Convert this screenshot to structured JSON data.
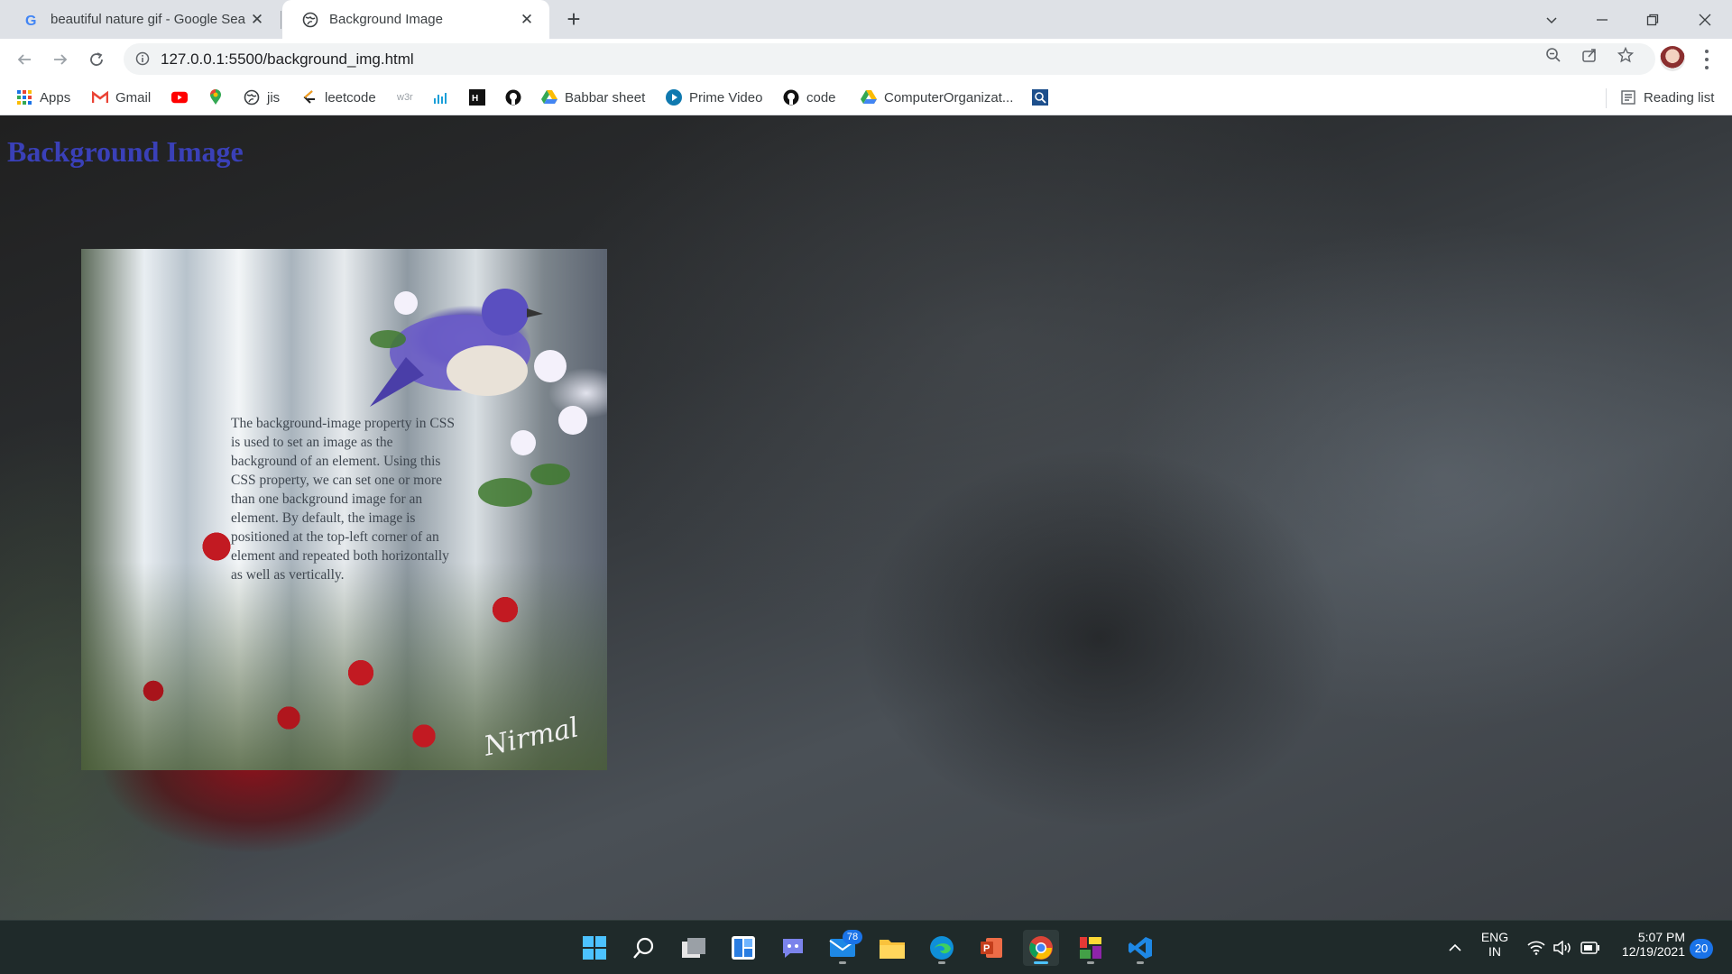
{
  "browser": {
    "tabs": [
      {
        "title": "beautiful nature gif - Google Sea",
        "favicon": "google-g-icon",
        "active": false
      },
      {
        "title": "Background Image",
        "favicon": "globe-icon",
        "active": true
      }
    ],
    "url": "127.0.0.1:5500/background_img.html",
    "bookmarks": [
      {
        "label": "Apps",
        "icon": "apps-grid-icon"
      },
      {
        "label": "Gmail",
        "icon": "gmail-icon"
      },
      {
        "label": "",
        "icon": "youtube-icon"
      },
      {
        "label": "",
        "icon": "maps-icon"
      },
      {
        "label": "jis",
        "icon": "globe-icon"
      },
      {
        "label": "leetcode",
        "icon": "leetcode-icon"
      },
      {
        "label": "w3r",
        "icon": "w3resource-icon"
      },
      {
        "label": "",
        "icon": "chart-icon"
      },
      {
        "label": "",
        "icon": "hackerrank-icon"
      },
      {
        "label": "",
        "icon": "github-icon"
      },
      {
        "label": "Babbar sheet",
        "icon": "drive-icon"
      },
      {
        "label": "Prime Video",
        "icon": "prime-video-icon"
      },
      {
        "label": "code",
        "icon": "github-icon"
      },
      {
        "label": "ComputerOrganizat...",
        "icon": "drive-icon"
      },
      {
        "label": "",
        "icon": "search-box-icon"
      }
    ],
    "reading_list": "Reading list"
  },
  "page": {
    "heading": "Background Image",
    "paragraph": "The background-image property in CSS is used to set an image as the background of an element. Using this CSS property, we can set one or more than one background image for an element. By default, the image is positioned at the top-left corner of an element and repeated both horizontally as well as vertically.",
    "signature": "Nirmal"
  },
  "taskbar": {
    "apps": [
      "start",
      "search",
      "task-view",
      "widgets",
      "teams-chat",
      "mail",
      "file-explorer",
      "edge",
      "powerpoint",
      "chrome",
      "colorful-app",
      "vscode"
    ],
    "mail_badge": "78",
    "language_line1": "ENG",
    "language_line2": "IN",
    "time": "5:07 PM",
    "date": "12/19/2021",
    "notifications": "20"
  },
  "colors": {
    "heading": "#3a40b8",
    "taskbar": "#1f2a2a",
    "tabstrip": "#dee1e6",
    "accent_blue": "#1a73e8"
  }
}
